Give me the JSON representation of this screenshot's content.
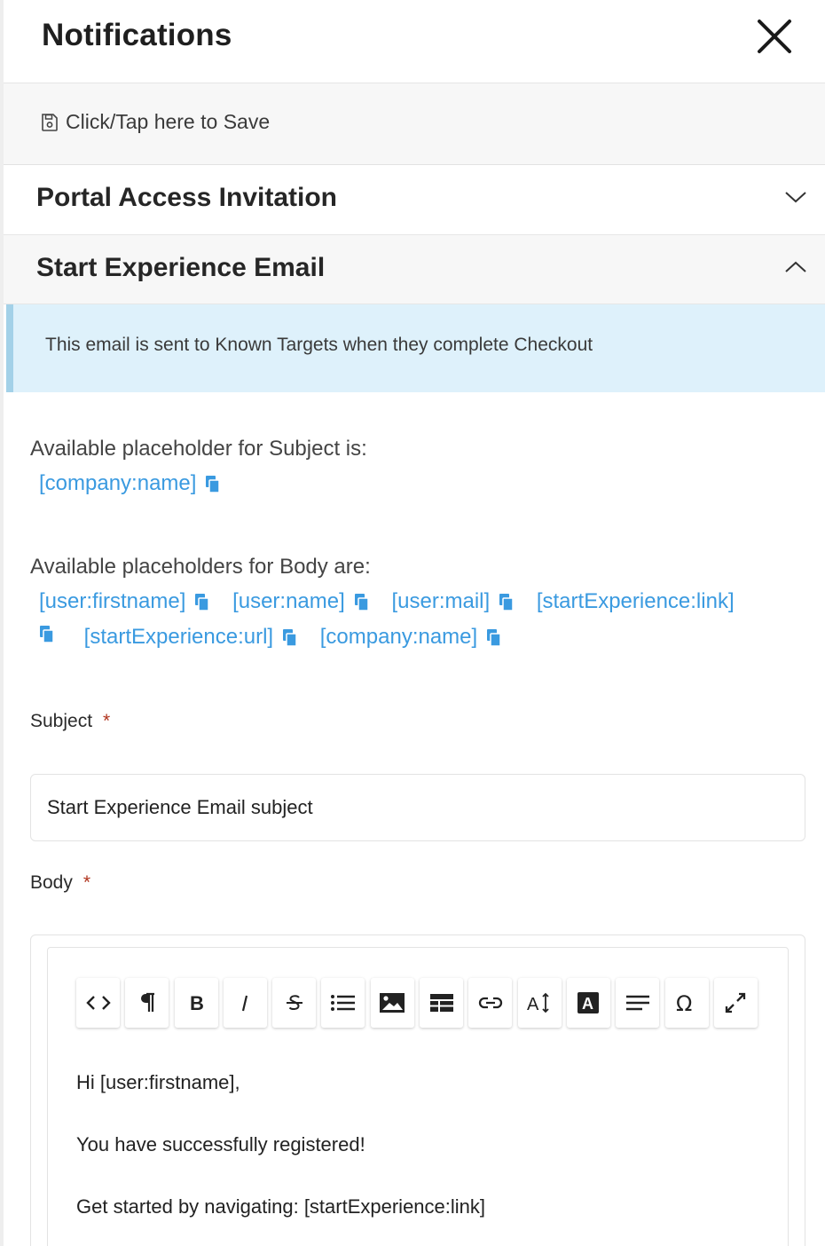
{
  "header": {
    "title": "Notifications",
    "close_icon": "close-icon"
  },
  "savebar": {
    "label": "Click/Tap here to Save",
    "icon": "save-icon"
  },
  "accordions": [
    {
      "title": "Portal Access Invitation",
      "state": "collapsed",
      "icon": "chevron-down-icon"
    },
    {
      "title": "Start Experience Email",
      "state": "expanded",
      "icon": "chevron-up-icon"
    }
  ],
  "info": {
    "text": "This email is sent to Known Targets when they complete Checkout"
  },
  "subject_placeholders": {
    "label": "Available placeholder for Subject is:",
    "items": [
      "[company:name]"
    ]
  },
  "body_placeholders": {
    "label": "Available placeholders for Body are:",
    "items": [
      "[user:firstname]",
      "[user:name]",
      "[user:mail]",
      "[startExperience:link]",
      "[startExperience:url]",
      "[company:name]"
    ]
  },
  "subject": {
    "label": "Subject",
    "required_mark": "*",
    "value": "Start Experience Email subject"
  },
  "body": {
    "label": "Body",
    "required_mark": "*",
    "toolbar": [
      "code-view-icon",
      "paragraph-icon",
      "bold-icon",
      "italic-icon",
      "strikethrough-icon",
      "list-icon",
      "image-icon",
      "table-icon",
      "link-icon",
      "font-size-icon",
      "text-color-icon",
      "align-icon",
      "special-characters-icon",
      "fullscreen-icon"
    ],
    "lines": [
      "Hi [user:firstname],",
      "You have successfully registered!",
      "Get started by navigating: [startExperience:link]"
    ]
  },
  "colors": {
    "link": "#3a9ae0",
    "info_bg": "#def1fb",
    "info_border": "#a3d1e8",
    "required": "#b0341e"
  }
}
